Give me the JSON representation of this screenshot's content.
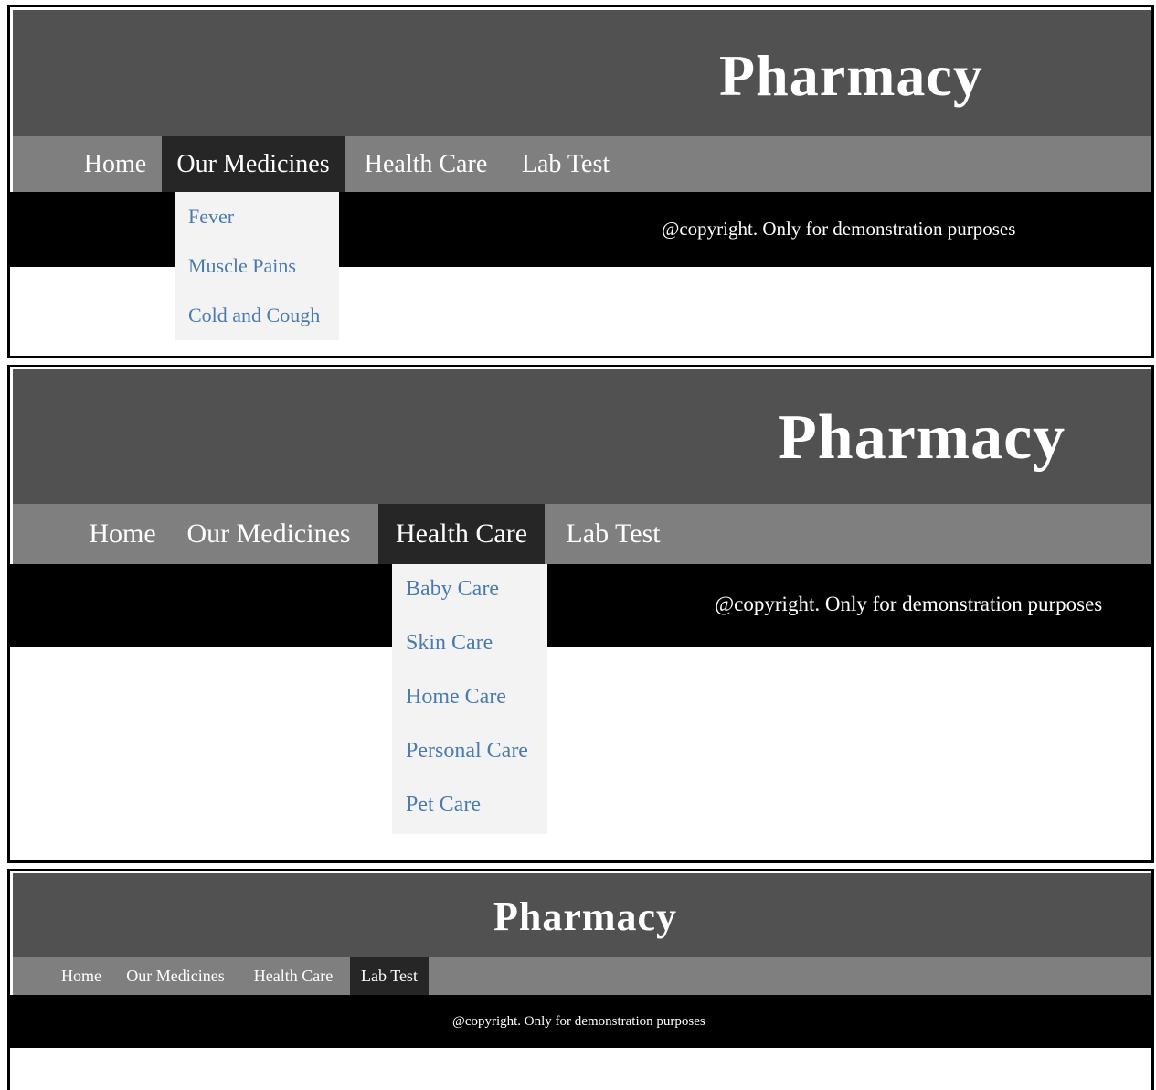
{
  "site": {
    "title": "Pharmacy",
    "footer": "@copyright. Only for demonstration purposes"
  },
  "nav": {
    "home": "Home",
    "medicines": "Our Medicines",
    "health_care": "Health Care",
    "lab_test": "Lab Test"
  },
  "medicines_menu": [
    "Fever",
    "Muscle Pains",
    "Cold and Cough"
  ],
  "health_care_menu": [
    "Baby Care",
    "Skin Care",
    "Home Care",
    "Personal Care",
    "Pet Care"
  ],
  "colors": {
    "header_bg": "#515151",
    "nav_bg": "#7f7f7f",
    "nav_active_bg": "#262626",
    "footer_bg": "#000000",
    "dropdown_bg": "#f3f3f3",
    "dropdown_link": "#4a7bb0"
  }
}
